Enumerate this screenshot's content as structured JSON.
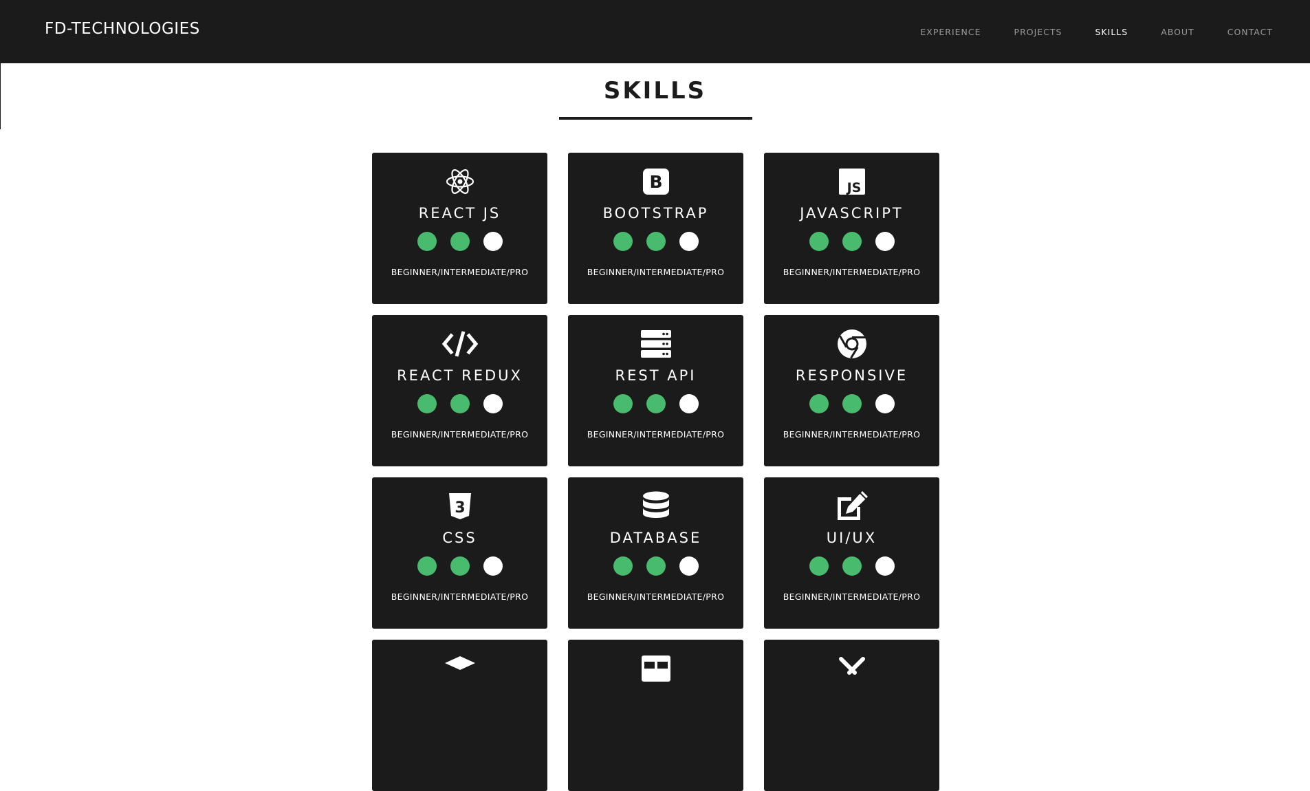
{
  "nav": {
    "brand": "FD-TECHNOLOGIES",
    "links": [
      {
        "label": "EXPERIENCE",
        "active": false
      },
      {
        "label": "PROJECTS",
        "active": false
      },
      {
        "label": "SKILLS",
        "active": true
      },
      {
        "label": "ABOUT",
        "active": false
      },
      {
        "label": "CONTACT",
        "active": false
      }
    ]
  },
  "section": {
    "title": "SKILLS"
  },
  "colors": {
    "filled": "#48bb6e",
    "empty": "#ffffff",
    "card": "#1b1b1b"
  },
  "skills": [
    {
      "name": "REACT JS",
      "icon": "react-icon",
      "level": "BEGINNER/INTERMEDIATE/PRO",
      "filled": 2,
      "total": 3
    },
    {
      "name": "BOOTSTRAP",
      "icon": "bootstrap-icon",
      "level": "BEGINNER/INTERMEDIATE/PRO",
      "filled": 2,
      "total": 3
    },
    {
      "name": "JAVASCRIPT",
      "icon": "js-icon",
      "level": "BEGINNER/INTERMEDIATE/PRO",
      "filled": 2,
      "total": 3
    },
    {
      "name": "REACT REDUX",
      "icon": "code-icon",
      "level": "BEGINNER/INTERMEDIATE/PRO",
      "filled": 2,
      "total": 3
    },
    {
      "name": "REST API",
      "icon": "server-icon",
      "level": "BEGINNER/INTERMEDIATE/PRO",
      "filled": 2,
      "total": 3
    },
    {
      "name": "RESPONSIVE",
      "icon": "chrome-icon",
      "level": "BEGINNER/INTERMEDIATE/PRO",
      "filled": 2,
      "total": 3
    },
    {
      "name": "CSS",
      "icon": "css3-icon",
      "level": "BEGINNER/INTERMEDIATE/PRO",
      "filled": 2,
      "total": 3
    },
    {
      "name": "DATABASE",
      "icon": "database-icon",
      "level": "BEGINNER/INTERMEDIATE/PRO",
      "filled": 2,
      "total": 3
    },
    {
      "name": "UI/UX",
      "icon": "edit-icon",
      "level": "BEGINNER/INTERMEDIATE/PRO",
      "filled": 2,
      "total": 3
    },
    {
      "name": "",
      "icon": "layers-icon",
      "level": "",
      "filled": 0,
      "total": 0
    },
    {
      "name": "",
      "icon": "table-icon",
      "level": "",
      "filled": 0,
      "total": 0
    },
    {
      "name": "",
      "icon": "tools-icon",
      "level": "",
      "filled": 0,
      "total": 0
    }
  ]
}
